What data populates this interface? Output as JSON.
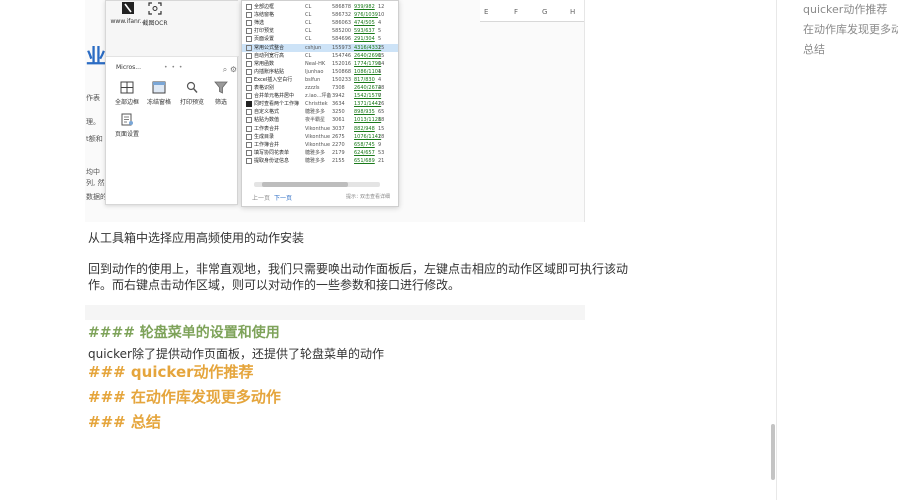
{
  "embed": {
    "bg_texts": [
      "作表",
      "理。",
      "t额和",
      "均中",
      "列, 然",
      "数据的"
    ],
    "bg_blue_glyph": "业",
    "sheet_columns": [
      "E",
      "F",
      "G",
      "H"
    ],
    "panel": {
      "top_tiles": [
        {
          "label": "www.ifanr...",
          "icon": "ifanr-logo-icon"
        },
        {
          "label": "截图OCR",
          "icon": "screenshot-ocr-icon"
        }
      ],
      "bar_title": "Micros...",
      "bar_dots": "• • •",
      "bar_buttons": "⌕ ⚙",
      "actions": [
        {
          "label": "全部边框",
          "icon": "border-grid-icon"
        },
        {
          "label": "冻结窗格",
          "icon": "freeze-pane-icon"
        },
        {
          "label": "打印预览",
          "icon": "print-preview-icon"
        },
        {
          "label": "筛选",
          "icon": "filter-icon"
        },
        {
          "label": "页面设置",
          "icon": "page-setup-icon"
        }
      ]
    },
    "action_list": {
      "rows": [
        {
          "name": "全部边框",
          "author": "CL",
          "n1": "586878",
          "n2": "939/982",
          "n3": "12"
        },
        {
          "name": "冻结窗格",
          "author": "CL",
          "n1": "586732",
          "n2": "976/1039",
          "n3": "10"
        },
        {
          "name": "筛选",
          "author": "CL",
          "n1": "586063",
          "n2": "474/505",
          "n3": "4"
        },
        {
          "name": "打印预览",
          "author": "CL",
          "n1": "585200",
          "n2": "593/637",
          "n3": "5"
        },
        {
          "name": "页面设置",
          "author": "CL",
          "n1": "584696",
          "n2": "291/304",
          "n3": "5"
        },
        {
          "name": "常用公式整合",
          "author": "cshjun",
          "n1": "155973",
          "n2": "4316/4332",
          "n3": "15",
          "highlight": true
        },
        {
          "name": "自动列宽行高",
          "author": "CL",
          "n1": "154746",
          "n2": "2640/2690",
          "n3": "15"
        },
        {
          "name": "常用函数",
          "author": "Neal-HK",
          "n1": "152016",
          "n2": "1774/1790",
          "n3": "14"
        },
        {
          "name": "内插账序粘贴",
          "author": "ljunhao",
          "n1": "150868",
          "n2": "1086/1101",
          "n3": "4"
        },
        {
          "name": "Excel插入空白行",
          "author": "bslfun",
          "n1": "150233",
          "n2": "817/830",
          "n3": "4"
        },
        {
          "name": "表格识别",
          "author": "zzzzls",
          "n1": "7308",
          "n2": "2640/2674",
          "n3": "28"
        },
        {
          "name": "合并单元格并居中",
          "author": "z.iao...坪备",
          "n1": "3942",
          "n2": "1542/1570",
          "n3": "7"
        },
        {
          "name": "同时查看两个工作簿",
          "author": "Christtek",
          "n1": "3634",
          "n2": "1371/1442",
          "n3": "16",
          "dark": true
        },
        {
          "name": "自定义格式",
          "author": "糖雅多多",
          "n1": "3250",
          "n2": "898/935",
          "n3": "65"
        },
        {
          "name": "粘贴为数值",
          "author": "夜半霸星",
          "n1": "3061",
          "n2": "1013/1128",
          "n3": "18"
        },
        {
          "name": "工作表合并",
          "author": "Vikonthue",
          "n1": "3037",
          "n2": "882/948",
          "n3": "15"
        },
        {
          "name": "生成目录",
          "author": "Vikonthue",
          "n1": "2675",
          "n2": "1076/1142",
          "n3": "18"
        },
        {
          "name": "工作簿合并",
          "author": "Vikonthue",
          "n1": "2270",
          "n2": "658/745",
          "n3": "9"
        },
        {
          "name": "填写协同花表单",
          "author": "糖雅多多",
          "n1": "2179",
          "n2": "624/657",
          "n3": "53"
        },
        {
          "name": "提取身份证信息",
          "author": "糖雅多多",
          "n1": "2155",
          "n2": "651/689",
          "n3": "21"
        }
      ],
      "prev_label": "上一页",
      "next_label": "下一页",
      "hint_label": "提示：",
      "hint_text": "双击查看详细"
    }
  },
  "doc": {
    "caption": "从工具箱中选择应用高频使用的动作安装",
    "paragraph_line1": "回到动作的使用上，非常直观地，我们只需要唤出动作面板后，左键点击相应的动作区域即可执行该动",
    "paragraph_line2": "作。而右键点击动作区域，则可以对动作的一些参数和接口进行修改。",
    "heading_wheel": "#### 轮盘菜单的设置和使用",
    "wheel_text": "quicker除了提供动作页面板，还提供了轮盘菜单的动作",
    "heading_recommend": "### quicker动作推荐",
    "heading_library": "### 在动作库发现更多动作",
    "heading_summary": "### 总结"
  },
  "outline": {
    "items": [
      "quicker动作推荐",
      "在动作库发现更多动作",
      "总结"
    ]
  },
  "colors": {
    "green_heading": "#7ea35a",
    "orange_heading": "#e5a53c",
    "highlight_row": "#cde3f7",
    "outline_text": "#8a8a8a"
  }
}
